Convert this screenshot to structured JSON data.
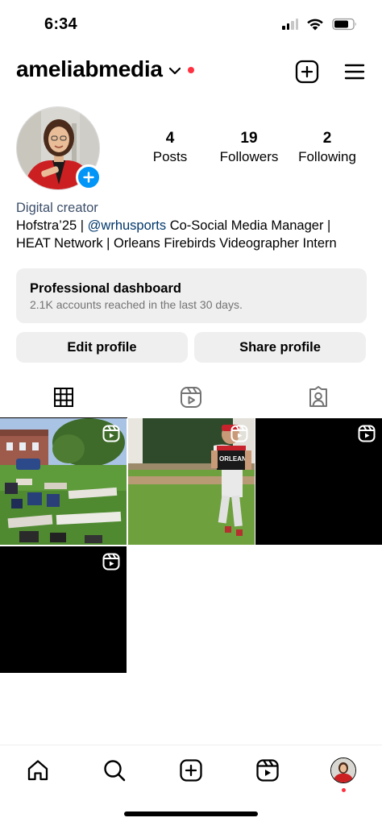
{
  "status_bar": {
    "time": "6:34"
  },
  "header": {
    "username": "ameliabmedia"
  },
  "stats": [
    {
      "value": "4",
      "label": "Posts"
    },
    {
      "value": "19",
      "label": "Followers"
    },
    {
      "value": "2",
      "label": "Following"
    }
  ],
  "bio": {
    "category": "Digital creator",
    "line1_start": "Hofstra’25 | ",
    "mention": "@wrhusports",
    "line1_end": " Co-Social Media Manager |",
    "line2": "HEAT Network | Orleans Firebirds Videographer Intern"
  },
  "dashboard": {
    "title": "Professional dashboard",
    "subtitle": "2.1K accounts reached in the last 30 days."
  },
  "buttons": {
    "edit": "Edit profile",
    "share": "Share profile"
  },
  "tabs": [
    "grid-icon",
    "reels-icon",
    "tagged-icon"
  ],
  "posts": [
    {
      "type": "reel",
      "scene": "lawn with blankets and chairs"
    },
    {
      "type": "reel",
      "scene": "baseball player",
      "jersey_text": "ORLEANS"
    },
    {
      "type": "reel",
      "scene": "black"
    },
    {
      "type": "reel",
      "scene": "black"
    }
  ],
  "bottom_nav": [
    "home-icon",
    "search-icon",
    "create-icon",
    "reels-icon",
    "profile-avatar"
  ],
  "colors": {
    "accent_blue": "#0095f6",
    "notification_red": "#ff3040",
    "mention_blue": "#00376b",
    "button_gray": "#efefef"
  }
}
